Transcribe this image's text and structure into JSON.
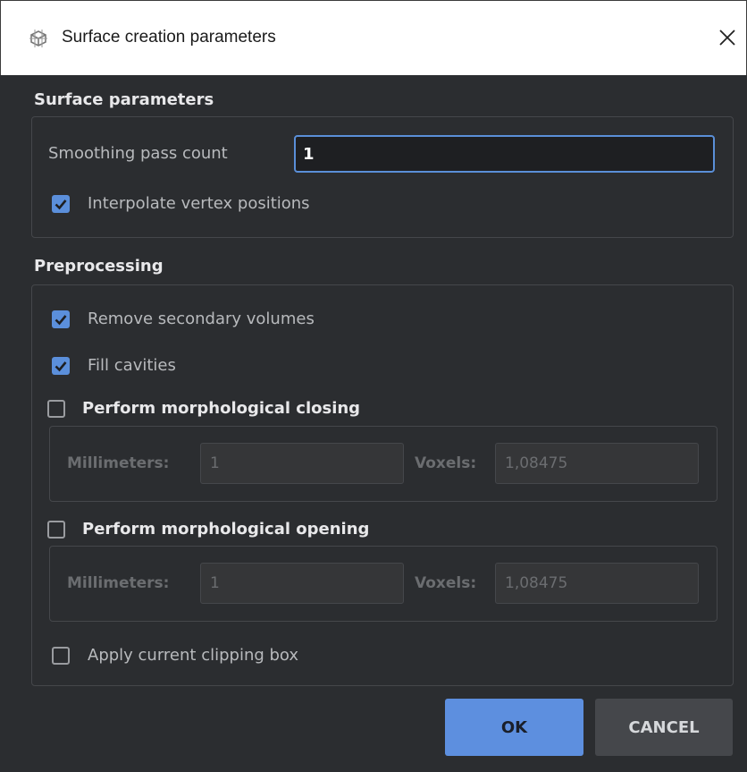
{
  "window": {
    "title": "Surface creation parameters"
  },
  "surface_parameters": {
    "heading": "Surface parameters",
    "smoothing_label": "Smoothing pass count",
    "smoothing_value": "1",
    "interpolate_label": "Interpolate vertex positions",
    "interpolate_checked": true
  },
  "preprocessing": {
    "heading": "Preprocessing",
    "remove_secondary_label": "Remove secondary volumes",
    "remove_secondary_checked": true,
    "fill_cavities_label": "Fill cavities",
    "fill_cavities_checked": true,
    "closing": {
      "label": "Perform morphological closing",
      "checked": false,
      "mm_label": "Millimeters:",
      "mm_value": "1",
      "voxels_label": "Voxels:",
      "voxels_value": "1,08475"
    },
    "opening": {
      "label": "Perform morphological opening",
      "checked": false,
      "mm_label": "Millimeters:",
      "mm_value": "1",
      "voxels_label": "Voxels:",
      "voxels_value": "1,08475"
    },
    "clipping_label": "Apply current clipping box",
    "clipping_checked": false
  },
  "buttons": {
    "ok_label": "OK",
    "cancel_label": "CANCEL"
  },
  "colors": {
    "background": "#2b2d30",
    "accent": "#5b8fdb",
    "titlebar": "#ffffff"
  },
  "icons": {
    "title_icon": "surface-mesh-icon",
    "close_icon": "close-icon",
    "check_icon": "checkmark-icon"
  }
}
